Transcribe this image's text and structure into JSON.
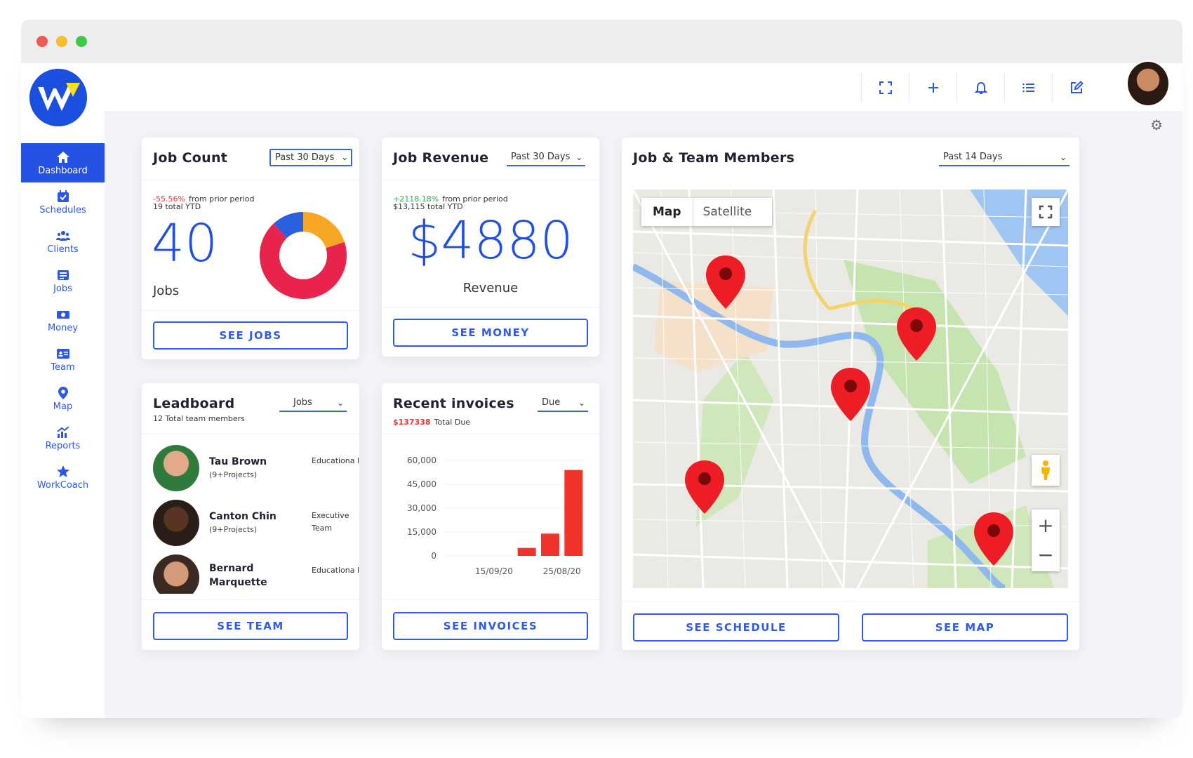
{
  "window": {
    "traffic_lights": [
      "#ee5a52",
      "#f5bd2f",
      "#3fc748"
    ]
  },
  "sidebar": {
    "items": [
      {
        "label": "Dashboard",
        "icon": "home-icon",
        "active": true
      },
      {
        "label": "Schedules",
        "icon": "calendar-icon"
      },
      {
        "label": "Clients",
        "icon": "users-icon"
      },
      {
        "label": "Jobs",
        "icon": "list-icon"
      },
      {
        "label": "Money",
        "icon": "money-icon"
      },
      {
        "label": "Team",
        "icon": "id-card-icon"
      },
      {
        "label": "Map",
        "icon": "map-pin-icon"
      },
      {
        "label": "Reports",
        "icon": "chart-icon"
      },
      {
        "label": "WorkCoach",
        "icon": "star-icon"
      }
    ]
  },
  "topbar": {
    "icons": [
      "expand-icon",
      "plus-icon",
      "bell-icon",
      "list-icon",
      "edit-icon"
    ]
  },
  "job_count": {
    "title": "Job Count",
    "period": "Past 30 Days",
    "change": "-55.56%",
    "change_suffix": "from prior period",
    "ytd": "19 total YTD",
    "value": "40",
    "unit": "Jobs",
    "button": "SEE JOBS",
    "donut_colors": [
      "#f5a623",
      "#e8244d",
      "#2a60e0"
    ],
    "donut_shares": [
      0.2,
      0.68,
      0.12
    ]
  },
  "job_revenue": {
    "title": "Job Revenue",
    "period": "Past 30 Days",
    "change": "+2118.18%",
    "change_suffix": "from prior period",
    "ytd": "$13,115 total YTD",
    "value": "$4880",
    "unit": "Revenue",
    "button": "SEE MONEY"
  },
  "team_map": {
    "title": "Job & Team Members",
    "period": "Past 14 Days",
    "map_tab_active": "Map",
    "map_tab_other": "Satellite",
    "button_schedule": "SEE SCHEDULE",
    "button_map": "SEE MAP"
  },
  "leaderboard": {
    "title": "Leadboard",
    "subtitle": "12 Total team members",
    "filter": "Jobs",
    "button": "SEE TEAM",
    "members": [
      {
        "name": "Tau Brown",
        "sub": "(9+Projects)",
        "role": "Educationa l"
      },
      {
        "name": "Canton Chin",
        "sub": "(9+Projects)",
        "role": "Executive Team"
      },
      {
        "name": "Bernard Marquette",
        "sub": "",
        "role": "Educationa l"
      }
    ]
  },
  "invoices": {
    "title": "Recent invoices",
    "total_amount": "$137338",
    "total_label": "Total Due",
    "filter": "Due",
    "button": "SEE INVOICES"
  },
  "chart_data": {
    "type": "bar",
    "title": "",
    "xlabel": "",
    "ylabel": "",
    "ylim": [
      0,
      60000
    ],
    "y_ticks": [
      "60,000",
      "45,000",
      "30,000",
      "15,000",
      "0"
    ],
    "x_tick_labels": [
      "15/09/20",
      "25/08/20"
    ],
    "values": [
      0,
      0,
      0,
      5000,
      14000,
      54000
    ],
    "bar_color": "#f0342c"
  }
}
